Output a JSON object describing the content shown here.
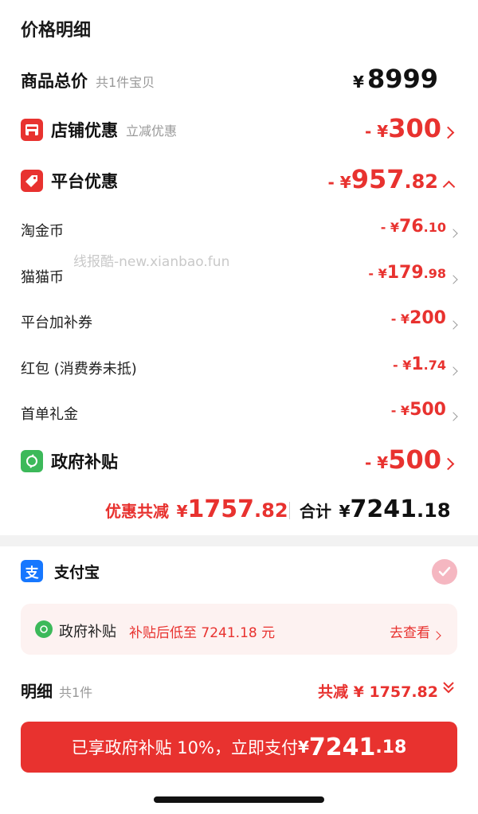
{
  "title": "价格明细",
  "total": {
    "label": "商品总价",
    "sub": "共1件宝贝",
    "yen": "¥",
    "amount": "8999"
  },
  "store": {
    "label": "店铺优惠",
    "sub": "立减优惠",
    "prefix": "- ¥",
    "amount": "300"
  },
  "platform": {
    "label": "平台优惠",
    "prefix": "- ¥",
    "int": "957",
    "dec": ".82"
  },
  "items": [
    {
      "label": "淘金币",
      "prefix": "- ¥",
      "int": "76",
      "dec": ".10"
    },
    {
      "label": "猫猫币",
      "prefix": "- ¥",
      "int": "179",
      "dec": ".98"
    },
    {
      "label": "平台加补券",
      "prefix": "- ¥",
      "int": "200",
      "dec": ""
    },
    {
      "label": "红包 (消费券未抵)",
      "prefix": "- ¥",
      "int": "1",
      "dec": ".74"
    },
    {
      "label": "首单礼金",
      "prefix": "- ¥",
      "int": "500",
      "dec": ""
    }
  ],
  "watermark": "线报酷-new.xianbao.fun",
  "gov": {
    "label": "政府补贴",
    "prefix": "- ¥",
    "amount": "500"
  },
  "summary": {
    "discount_label": "优惠共减",
    "discount_yen": "¥",
    "discount_int": "1757",
    "discount_dec": ".82",
    "total_label": "合计",
    "total_yen": "¥",
    "total_int": "7241",
    "total_dec": ".18"
  },
  "payment": {
    "alipay_label": "支付宝"
  },
  "subsidy_box": {
    "label": "政府补贴",
    "desc": "补贴后低至 7241.18 元",
    "link": "去查看"
  },
  "detail": {
    "label": "明细",
    "sub": "共1件",
    "total_label": "共减 ¥ 1757.82"
  },
  "pay_button": {
    "text": "已享政府补贴 10%，立即支付 ",
    "yen": "¥",
    "int": "7241",
    "dec": ".18"
  },
  "colors": {
    "accent": "#e8322f",
    "alipay": "#1677ff",
    "gov_green": "#3cb95a",
    "check_pink": "#f5b7c1"
  }
}
